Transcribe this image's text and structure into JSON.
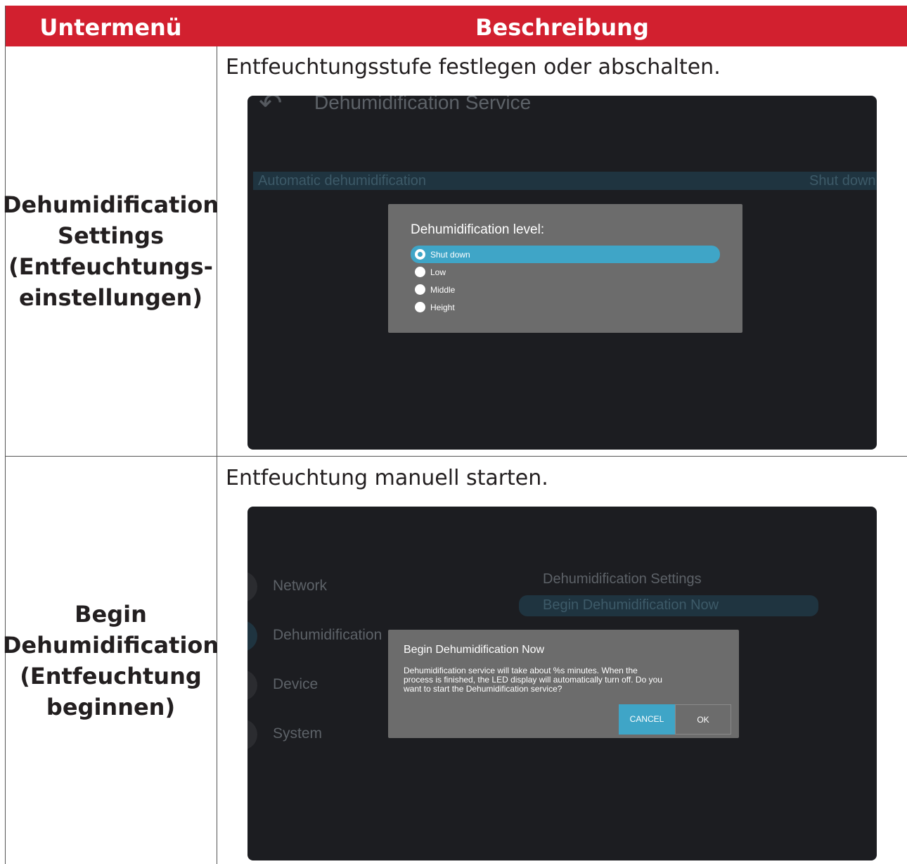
{
  "table": {
    "header": {
      "col1": "Untermenü",
      "col2": "Beschreibung"
    },
    "rows": [
      {
        "submenu": [
          "Dehumidification",
          "Settings",
          "(Entfeuchtungs-",
          "einstellungen)"
        ],
        "description": "Entfeuchtungsstufe festlegen oder abschalten.",
        "screenshot": {
          "title": "Dehumidification Service",
          "setting_label": "Automatic dehumidification",
          "setting_value": "Shut down",
          "dialog": {
            "title": "Dehumidification level:",
            "options": [
              "Shut down",
              "Low",
              "Middle",
              "Height"
            ],
            "selected": "Shut down"
          }
        }
      },
      {
        "submenu": [
          "Begin",
          "Dehumidification",
          "(Entfeuchtung",
          "beginnen)"
        ],
        "description": "Entfeuchtung manuell starten.",
        "screenshot": {
          "menu": [
            "Network",
            "Dehumidification",
            "Device",
            "System"
          ],
          "submenu_items": [
            "Dehumidification Settings",
            "Begin Dehumidification Now"
          ],
          "dialog": {
            "title": "Begin Dehumidification Now",
            "message": [
              "Dehumidification service will take about %s minutes. When the",
              "process is finished, the LED display will automatically turn off. Do you",
              "want to start the Dehumidification service?"
            ],
            "cancel_label": "CANCEL",
            "ok_label": "OK"
          }
        }
      }
    ]
  },
  "colors": {
    "header_red": "#d2202f",
    "accent_blue": "#3fa5c7",
    "screen_bg": "#1c1d21",
    "dialog_gray": "#6c6c6c"
  }
}
